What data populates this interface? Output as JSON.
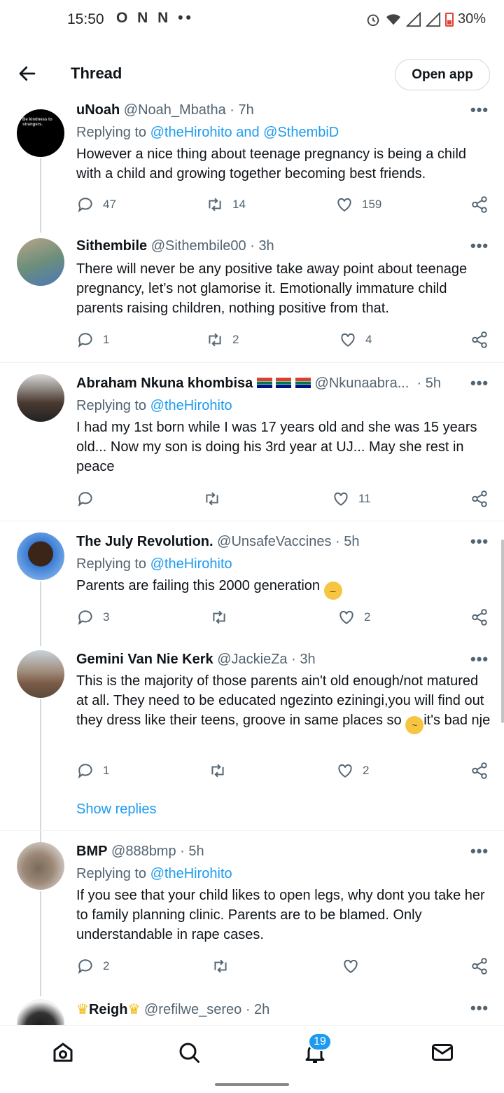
{
  "status_bar": {
    "time": "15:50",
    "left_icons": "O N N ••",
    "battery": "30%"
  },
  "header": {
    "title": "Thread",
    "open_app": "Open app"
  },
  "tweets": [
    {
      "name": "uNoah",
      "handle": "@Noah_Mbatha",
      "time": "7h",
      "replying_prefix": "Replying to ",
      "replying_to": "@theHirohito and @SthembiD",
      "text": "However a nice thing about teenage pregnancy is being a child with a child and growing together becoming best friends.",
      "replies": "47",
      "retweets": "14",
      "likes": "159",
      "avatar_text": "Be kindness to strangers."
    },
    {
      "name": "Sithembile",
      "handle": "@Sithembile00",
      "time": "3h",
      "text": "There will never be any positive take away point about teenage pregnancy, let’s not glamorise it. Emotionally immature child parents raising children, nothing positive from that.",
      "replies": "1",
      "retweets": "2",
      "likes": "4"
    },
    {
      "name": "Abraham Nkuna khombisa",
      "handle": "@Nkunaabra...",
      "time": "5h",
      "replying_prefix": "Replying to ",
      "replying_to": "@theHirohito",
      "text": "I had my 1st born while I was 17 years old and she was 15 years old... Now my son is doing his 3rd year at UJ... May she rest in peace",
      "replies": "",
      "retweets": "",
      "likes": "11"
    },
    {
      "name": "The July Revolution.",
      "handle": "@UnsafeVaccines",
      "time": "5h",
      "replying_prefix": "Replying to ",
      "replying_to": "@theHirohito",
      "text": "Parents are failing this 2000 generation",
      "replies": "3",
      "retweets": "",
      "likes": "2"
    },
    {
      "name": "Gemini Van Nie Kerk",
      "handle": "@JackieZa",
      "time": "3h",
      "text_a": "This is the majority of those parents ain't old enough/not matured at all. They need to be educated ngezinto eziningi,you will find out they dress like their teens, groove in same places so ",
      "text_b": "it's bad nje",
      "replies": "1",
      "retweets": "",
      "likes": "2",
      "show_replies": "Show replies"
    },
    {
      "name": "BMP",
      "handle": "@888bmp",
      "time": "5h",
      "replying_prefix": "Replying to ",
      "replying_to": "@theHirohito",
      "text": "If you see that your child likes to open legs, why dont you take her to family planning clinic. Parents are to be blamed. Only understandable in rape cases.",
      "replies": "2",
      "retweets": "",
      "likes": ""
    },
    {
      "name": "Reigh",
      "handle": "@refilwe_sereo",
      "time": "2h"
    }
  ],
  "nav": {
    "notifications_badge": "19"
  },
  "colors": {
    "link": "#1d9bf0",
    "muted": "#536471",
    "text": "#0f1419"
  }
}
